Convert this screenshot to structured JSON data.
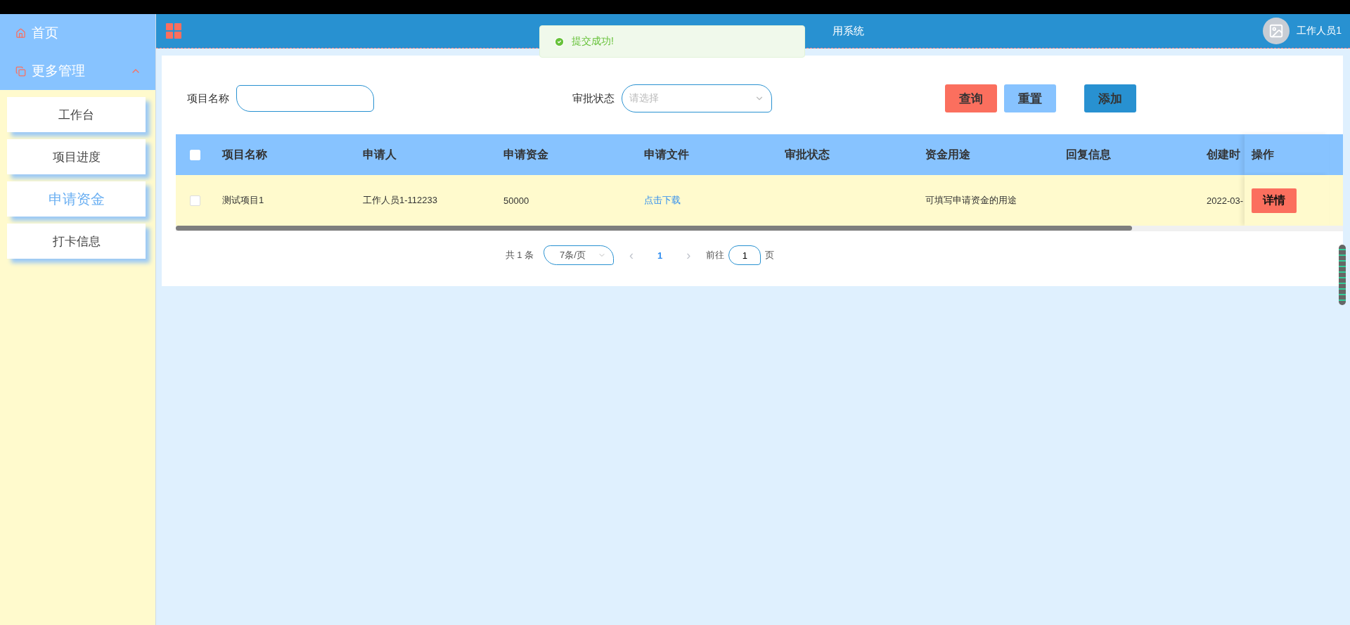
{
  "sidebar": {
    "menu": [
      {
        "label": "首页",
        "kind": "link"
      },
      {
        "label": "更多管理",
        "kind": "group",
        "expanded": true
      }
    ],
    "items": [
      {
        "label": "工作台",
        "selected": false
      },
      {
        "label": "项目进度",
        "selected": false
      },
      {
        "label": "申请资金",
        "selected": true
      },
      {
        "label": "打卡信息",
        "selected": false
      }
    ]
  },
  "header": {
    "title": "用系统",
    "user": "工作人员1"
  },
  "toast": {
    "message": "提交成功!"
  },
  "search": {
    "name_label": "项目名称",
    "status_label": "审批状态",
    "status_placeholder": "请选择",
    "buttons": [
      {
        "label": "查询",
        "kind": "query"
      },
      {
        "label": "重置",
        "kind": "reset"
      },
      {
        "label": "添加",
        "kind": "add"
      }
    ]
  },
  "table": {
    "all_checked": false,
    "columns": [
      "项目名称",
      "申请人",
      "申请资金",
      "申请文件",
      "审批状态",
      "资金用途",
      "回复信息",
      "创建时"
    ],
    "action_column": "操作",
    "rows": [
      {
        "checked": false,
        "cells": [
          "测试项目1",
          "工作人员1-112233",
          "50000",
          "点击下载",
          "",
          "可填写申请资金的用途",
          "",
          "2022-03-"
        ],
        "action": "详情"
      }
    ]
  },
  "pagination": {
    "total": "共 1 条",
    "page_size": "7条/页",
    "prev": "‹",
    "page": "1",
    "next": "›",
    "goto_label": "前往",
    "goto_value": "1",
    "goto_suffix": "页"
  }
}
